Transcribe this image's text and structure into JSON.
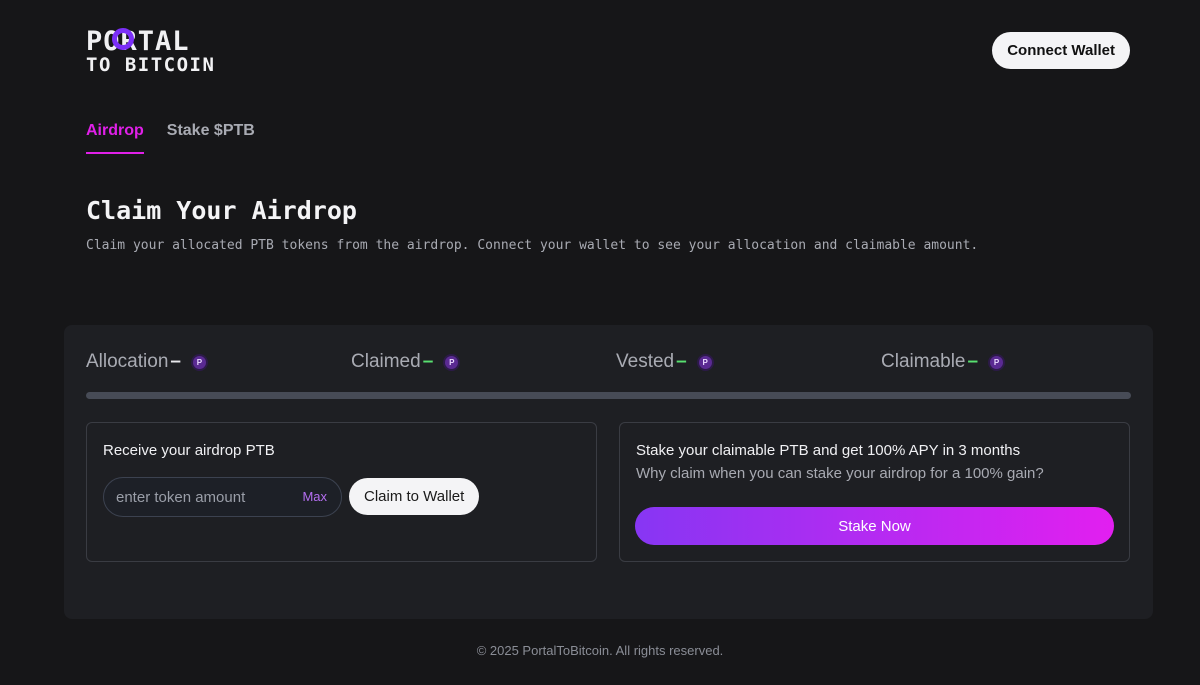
{
  "brand": {
    "line1": "PORTAL",
    "line2": "TO BITCOIN"
  },
  "header": {
    "connect_label": "Connect Wallet"
  },
  "tabs": [
    {
      "label": "Airdrop",
      "active": true
    },
    {
      "label": "Stake $PTB",
      "active": false
    }
  ],
  "hero": {
    "title": "Claim Your Airdrop",
    "subtitle": "Claim your allocated PTB tokens from the airdrop. Connect your wallet to see your allocation and claimable amount."
  },
  "stats": [
    {
      "label": "Allocation",
      "value": "–",
      "icon": "ptb-token-icon"
    },
    {
      "label": "Claimed",
      "value": "–",
      "icon": "ptb-token-icon"
    },
    {
      "label": "Vested",
      "value": "–",
      "icon": "ptb-token-icon"
    },
    {
      "label": "Claimable",
      "value": "–",
      "icon": "ptb-token-icon"
    }
  ],
  "progress": {
    "claimed_fraction": 0
  },
  "claim_card": {
    "title": "Receive your airdrop PTB",
    "input_placeholder": "enter token amount",
    "max_label": "Max",
    "claim_label": "Claim to Wallet"
  },
  "stake_card": {
    "title": "Stake your claimable PTB and get 100% APY in 3 months",
    "subtitle": "Why claim when you can stake your airdrop for a 100% gain?",
    "button_label": "Stake Now"
  },
  "footer": {
    "text": "© 2025 PortalToBitcoin. All rights reserved."
  },
  "colors": {
    "background": "#161618",
    "panel": "#1e1f23",
    "accent_magenta": "#e020e8",
    "accent_purple": "#8736f3",
    "dash_green": "#58e070"
  }
}
